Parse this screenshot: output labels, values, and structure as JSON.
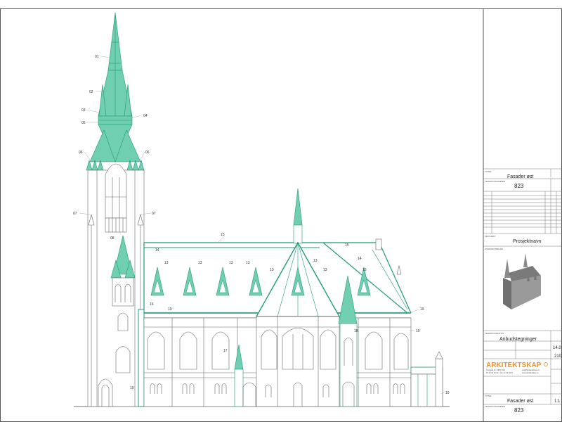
{
  "drawing": {
    "callouts": [
      "01",
      "02",
      "03",
      "04",
      "05",
      "06",
      "06",
      "07",
      "07",
      "08",
      "13",
      "13",
      "13",
      "13",
      "13",
      "13",
      "13",
      "13",
      "14",
      "14",
      "15",
      "15",
      "16",
      "19",
      "19",
      "19",
      "19",
      "17",
      "18",
      "19"
    ]
  },
  "title_block": {
    "sheet_title": "Fasader øst",
    "drawing_number": "823",
    "project_name": "Prosjektnavn",
    "phase": "Anbudstegninger",
    "date_partial": "14.0",
    "number_partial": "210",
    "scale_partial": "1:1",
    "bottom_title": "Fasader øst",
    "bottom_number": "823"
  },
  "firm": {
    "name": "ARKITEKTSKAP",
    "address": "Torggata 31, 0183 Oslo",
    "phone": "Tlf 22 00 00 00 · Fax 22 00 00 01",
    "email": "post@arkitektskap.no",
    "web": "www.arkitektskap.no"
  },
  "colors": {
    "roof": "#6fcfb0",
    "roof_stroke": "#1f9a77",
    "line": "#666666",
    "accent": "#f0902a"
  }
}
